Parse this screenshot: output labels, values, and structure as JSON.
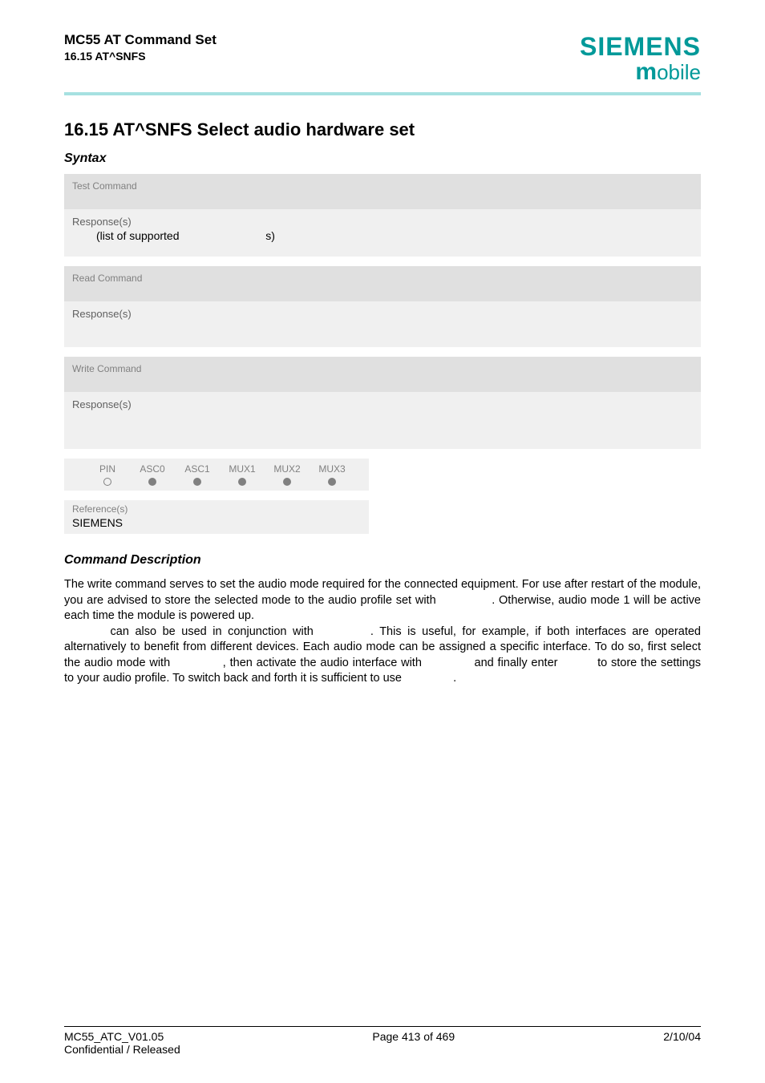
{
  "header": {
    "doc_title": "MC55 AT Command Set",
    "sub_title": "16.15 AT^SNFS",
    "brand_top": "SIEMENS",
    "brand_bottom_m": "m",
    "brand_bottom_rest": "obile"
  },
  "section": {
    "heading": "16.15    AT^SNFS   Select audio hardware set",
    "syntax_label": "Syntax"
  },
  "blocks": {
    "test": {
      "header": "Test Command",
      "resp_label": "Response(s)",
      "resp_line_a": "(list of supported ",
      "resp_line_b": "s)"
    },
    "read": {
      "header": "Read Command",
      "resp_label": "Response(s)"
    },
    "write": {
      "header": "Write Command",
      "resp_label": "Response(s)"
    }
  },
  "indicators": {
    "cols": [
      "PIN",
      "ASC0",
      "ASC1",
      "MUX1",
      "MUX2",
      "MUX3"
    ]
  },
  "reference": {
    "label": "Reference(s)",
    "value": "SIEMENS"
  },
  "description": {
    "heading": "Command Description",
    "p1a": "The write command serves to set the audio mode required for the connected equipment. For use after restart of the module, you are advised to store the selected mode to the audio profile set with ",
    "p1b": ". Otherwise, audio mode 1 will be active each time the module is powered up.",
    "p2a": " can also be used in conjunction with ",
    "p2b": ". This is useful, for example, if both interfaces are operated alternatively to benefit from different devices. Each audio mode can be assigned a specific interface. To do so, first select the audio mode with ",
    "p2c": ", then activate the audio interface with ",
    "p2d": " and finally enter ",
    "p2e": " to store the settings to your audio profile. To switch back and forth it is sufficient to use ",
    "p2f": "."
  },
  "footer": {
    "left1": "MC55_ATC_V01.05",
    "center": "Page 413 of 469",
    "right": "2/10/04",
    "left2": "Confidential / Released"
  }
}
